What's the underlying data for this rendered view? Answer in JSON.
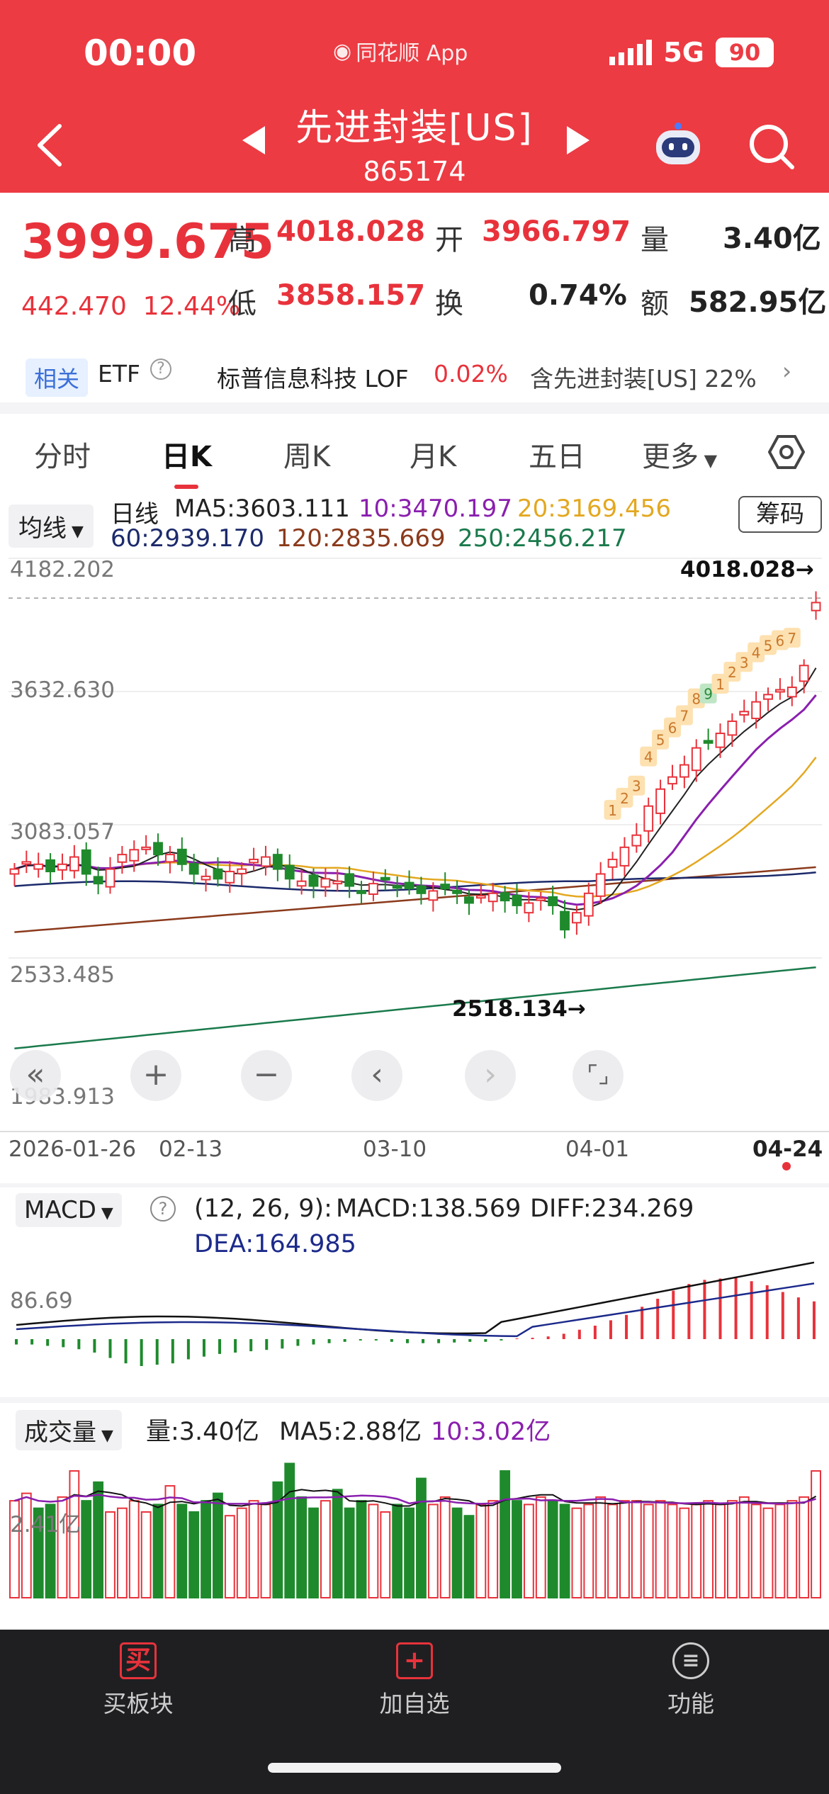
{
  "status_bar": {
    "time": "00:00",
    "app_name": "同花顺 App",
    "network": "5G",
    "battery": "90"
  },
  "header": {
    "title": "先进封装[US]",
    "code": "865174"
  },
  "quote": {
    "price": "3999.675",
    "change": "442.470",
    "change_pct": "12.44%",
    "high_label": "高",
    "high": "4018.028",
    "open_label": "开",
    "open": "3966.797",
    "volume_label": "量",
    "volume": "3.40亿",
    "low_label": "低",
    "low": "3858.157",
    "turnover_label": "换",
    "turnover": "0.74%",
    "amount_label": "额",
    "amount": "582.95亿"
  },
  "related": {
    "tag": "相关",
    "etf_label": "ETF",
    "etf_name": "标普信息科技 LOF",
    "etf_change": "0.02%",
    "contains_text": "含先进封装[US] 22%"
  },
  "tabs": {
    "items": [
      "分时",
      "日K",
      "周K",
      "月K",
      "五日",
      "更多"
    ],
    "active": "日K"
  },
  "kline": {
    "indicator_select": "均线",
    "period_label": "日线",
    "ma5": "MA5:3603.111",
    "ma10": "10:3470.197",
    "ma20": "20:3169.456",
    "ma60": "60:2939.170",
    "ma120": "120:2835.669",
    "ma250": "250:2456.217",
    "chip_button": "筹码",
    "max_label": "4018.028→",
    "min_label": "2518.134→"
  },
  "colors": {
    "up": "#e8323b",
    "down": "#1e8a2c",
    "ma5": "#222222",
    "ma10": "#8a1fae",
    "ma20": "#e3a820",
    "ma60": "#1c2a6b",
    "ma120": "#8b3a1c",
    "ma250": "#1a7a4c"
  },
  "macd": {
    "select": "MACD",
    "params": "(12, 26, 9):",
    "macd": "MACD:138.569",
    "diff": "DIFF:234.269",
    "dea": "DEA:164.985",
    "y_label": "86.69"
  },
  "volume_panel": {
    "select": "成交量",
    "vol": "量:3.40亿",
    "ma5": "MA5:2.88亿",
    "ma10": "10:3.02亿",
    "y_label": "2.41亿"
  },
  "chart_data": {
    "type": "candlestick",
    "y_axis_labels": [
      "4182.202",
      "3632.630",
      "3083.057",
      "2533.485",
      "1983.913"
    ],
    "x_axis_labels": [
      "2026-01-26",
      "02-13",
      "03-10",
      "04-01",
      "04-24"
    ],
    "ylim": [
      1983.913,
      4182.202
    ],
    "high": 4018.028,
    "low": 2518.134,
    "close_series_approx": [
      2900,
      2930,
      2920,
      2890,
      2920,
      2950,
      2880,
      2840,
      2900,
      2960,
      2980,
      2990,
      2960,
      2960,
      2920,
      2880,
      2870,
      2860,
      2890,
      2900,
      2940,
      2950,
      2900,
      2860,
      2850,
      2830,
      2860,
      2850,
      2830,
      2800,
      2840,
      2860,
      2830,
      2820,
      2800,
      2810,
      2820,
      2800,
      2760,
      2790,
      2800,
      2770,
      2750,
      2760,
      2780,
      2750,
      2650,
      2720,
      2800,
      2880,
      2940,
      2990,
      3040,
      3160,
      3230,
      3280,
      3330,
      3400,
      3420,
      3460,
      3510,
      3550,
      3590,
      3620,
      3640,
      3650,
      3740,
      3999.675
    ],
    "td_sequence_labels": [
      "1",
      "2",
      "3",
      "4",
      "5",
      "6",
      "7",
      "8",
      "9",
      "1",
      "2",
      "3",
      "4",
      "5",
      "6",
      "7"
    ],
    "macd_hist_approx": [
      -8,
      -8,
      -10,
      -12,
      -15,
      -20,
      -28,
      -36,
      -40,
      -38,
      -36,
      -30,
      -26,
      -22,
      -20,
      -18,
      -16,
      -14,
      -10,
      -8,
      -6,
      -4,
      -2,
      -2,
      -4,
      -6,
      -6,
      -6,
      -5,
      -4,
      -4,
      -2,
      1,
      2,
      4,
      8,
      14,
      20,
      28,
      36,
      48,
      60,
      72,
      82,
      88,
      90,
      92,
      86,
      80,
      70,
      62,
      56
    ],
    "volume_approx": [
      2.6,
      2.8,
      2.4,
      2.5,
      2.7,
      3.4,
      2.6,
      3.1,
      2.3,
      2.4,
      2.6,
      2.3,
      2.5,
      3.0,
      2.5,
      2.3,
      2.6,
      2.8,
      2.2,
      2.4,
      2.6,
      2.5,
      3.1,
      3.6,
      2.7,
      2.4,
      2.6,
      2.9,
      2.4,
      2.6,
      2.5,
      2.3,
      2.5,
      2.4,
      3.2,
      2.5,
      2.7,
      2.4,
      2.2,
      2.5,
      2.6,
      3.4,
      2.6,
      2.5,
      2.7,
      2.6,
      2.5,
      2.4,
      2.5,
      2.7,
      2.5,
      2.6,
      2.6,
      2.5,
      2.6,
      2.5,
      2.4,
      2.5,
      2.6,
      2.5,
      2.6,
      2.7,
      2.5,
      2.4,
      2.5,
      2.6,
      2.7,
      3.4
    ]
  },
  "bottom_nav": {
    "buy": "买板块",
    "add": "加自选",
    "func": "功能",
    "buy_icon": "买"
  }
}
